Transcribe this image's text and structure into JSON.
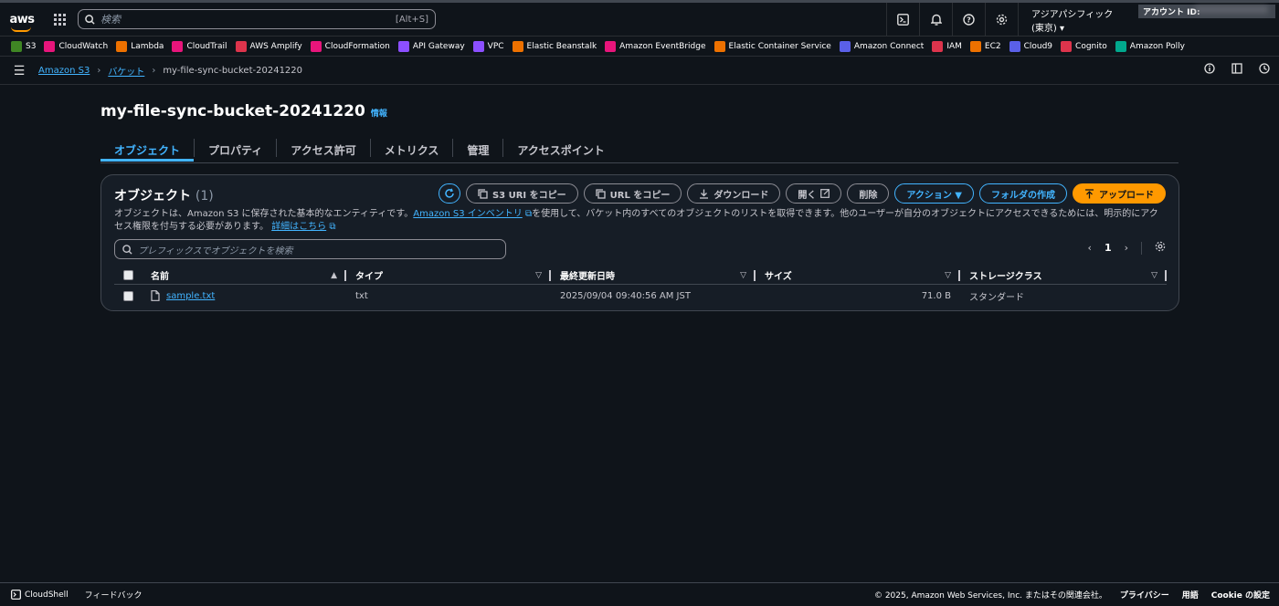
{
  "header": {
    "logo": "aws",
    "search_placeholder": "検索",
    "search_shortcut": "[Alt+S]",
    "region": "アジアパシフィック (東京) ▾",
    "account_label": "アカウント ID:"
  },
  "favorites": [
    {
      "label": "S3",
      "color": "#3f8624"
    },
    {
      "label": "CloudWatch",
      "color": "#e7157b"
    },
    {
      "label": "Lambda",
      "color": "#ed7100"
    },
    {
      "label": "CloudTrail",
      "color": "#e7157b"
    },
    {
      "label": "AWS Amplify",
      "color": "#dd344c"
    },
    {
      "label": "CloudFormation",
      "color": "#e7157b"
    },
    {
      "label": "API Gateway",
      "color": "#8c4fff"
    },
    {
      "label": "VPC",
      "color": "#8c4fff"
    },
    {
      "label": "Elastic Beanstalk",
      "color": "#ed7100"
    },
    {
      "label": "Amazon EventBridge",
      "color": "#e7157b"
    },
    {
      "label": "Elastic Container Service",
      "color": "#ed7100"
    },
    {
      "label": "Amazon Connect",
      "color": "#5a60e8"
    },
    {
      "label": "IAM",
      "color": "#dd344c"
    },
    {
      "label": "EC2",
      "color": "#ed7100"
    },
    {
      "label": "Cloud9",
      "color": "#5a60e8"
    },
    {
      "label": "Cognito",
      "color": "#dd344c"
    },
    {
      "label": "Amazon Polly",
      "color": "#01a88d"
    }
  ],
  "breadcrumb": {
    "root": "Amazon S3",
    "buckets": "バケット",
    "current": "my-file-sync-bucket-20241220"
  },
  "page": {
    "title": "my-file-sync-bucket-20241220",
    "info": "情報"
  },
  "tabs": [
    "オブジェクト",
    "プロパティ",
    "アクセス許可",
    "メトリクス",
    "管理",
    "アクセスポイント"
  ],
  "objects": {
    "heading": "オブジェクト",
    "count": "(1)",
    "buttons": {
      "copy_s3_uri": "S3 URI をコピー",
      "copy_url": "URL をコピー",
      "download": "ダウンロード",
      "open": "開く",
      "delete": "削除",
      "actions": "アクション ▼",
      "create_folder": "フォルダの作成",
      "upload": "アップロード"
    },
    "description_1": "オブジェクトは、Amazon S3 に保存された基本的なエンティティです。",
    "inventory_link": "Amazon S3 インベントリ",
    "description_2": "を使用して、バケット内のすべてのオブジェクトのリストを取得できます。他のユーザーが自分のオブジェクトにアクセスできるためには、明示的にアクセス権限を付与する必要があります。",
    "learn_more": "詳細はこちら",
    "filter_placeholder": "プレフィックスでオブジェクトを検索",
    "page_number": "1",
    "columns": [
      "名前",
      "タイプ",
      "最終更新日時",
      "サイズ",
      "ストレージクラス"
    ],
    "rows": [
      {
        "name": "sample.txt",
        "type": "txt",
        "modified": "2025/09/04 09:40:56 AM JST",
        "size": "71.0 B",
        "storage": "スタンダード"
      }
    ]
  },
  "footer": {
    "cloudshell": "CloudShell",
    "feedback": "フィードバック",
    "copyright": "© 2025, Amazon Web Services, Inc. またはその関連会社。",
    "privacy": "プライバシー",
    "terms": "用語",
    "cookie": "Cookie の設定"
  }
}
